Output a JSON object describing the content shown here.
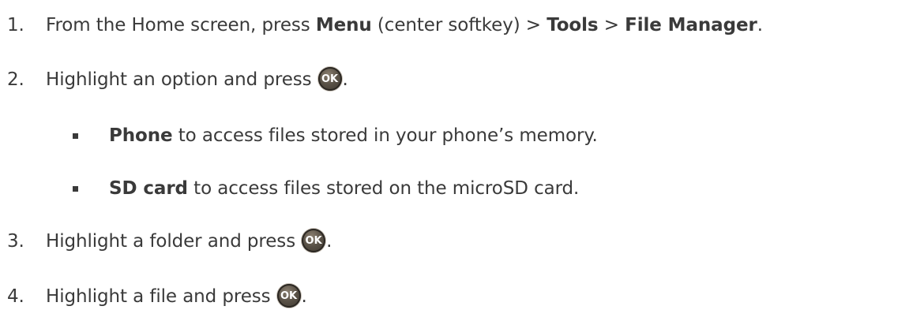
{
  "steps": [
    {
      "number": "1.",
      "parts": {
        "a": "From the Home screen, press ",
        "b": "Menu",
        "c": " (center softkey) > ",
        "d": "Tools",
        "e": " > ",
        "f": "File Manager",
        "g": "."
      }
    },
    {
      "number": "2.",
      "text": "Highlight an option and press",
      "end": "."
    },
    {
      "number": "3.",
      "text": "Highlight a folder and press",
      "end": "."
    },
    {
      "number": "4.",
      "text": "Highlight a file and press",
      "end": "."
    }
  ],
  "bullets": [
    {
      "bold": "Phone",
      "text": " to access files stored in your phone’s memory."
    },
    {
      "bold": "SD card",
      "text": " to access files stored on the microSD card."
    }
  ],
  "ok_key": {
    "label": "OK",
    "icon": "ok-key-icon"
  }
}
